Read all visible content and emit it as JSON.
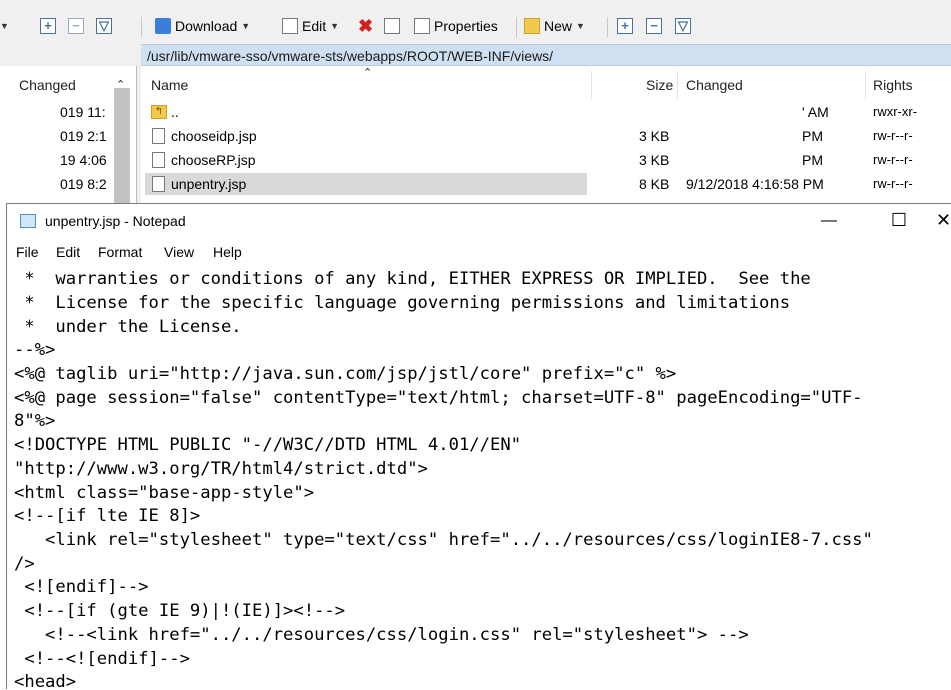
{
  "winscp": {
    "toolbar": {
      "download_label": "Download",
      "edit_label": "Edit",
      "properties_label": "Properties",
      "new_label": "New"
    },
    "path": "/usr/lib/vmware-sso/vmware-sts/webapps/ROOT/WEB-INF/views/",
    "left_panel": {
      "header": "Changed",
      "rows": [
        "019 11:",
        "019 2:1",
        "19 4:06",
        "019 8:2"
      ]
    },
    "right_panel": {
      "columns": {
        "name": "Name",
        "size": "Size",
        "changed": "Changed",
        "rights": "Rights"
      },
      "rows": [
        {
          "name": "..",
          "size": "",
          "changed": "' AM",
          "rights": "rwxr-xr-"
        },
        {
          "name": "chooseidp.jsp",
          "size": "3 KB",
          "changed": "PM",
          "rights": "rw-r--r-"
        },
        {
          "name": "chooseRP.jsp",
          "size": "3 KB",
          "changed": "PM",
          "rights": "rw-r--r-"
        },
        {
          "name": "unpentry.jsp",
          "size": "8 KB",
          "changed": "9/12/2018 4:16:58 PM",
          "rights": "rw-r--r-"
        }
      ]
    }
  },
  "notepad": {
    "title": "unpentry.jsp - Notepad",
    "menu": [
      "File",
      "Edit",
      "Format",
      "View",
      "Help"
    ],
    "lines": [
      " *  warranties or conditions of any kind, EITHER EXPRESS OR IMPLIED.  See the",
      " *  License for the specific language governing permissions and limitations",
      " *  under the License.",
      "--%>",
      "<%@ taglib uri=\"http://java.sun.com/jsp/jstl/core\" prefix=\"c\" %>",
      "<%@ page session=\"false\" contentType=\"text/html; charset=UTF-8\" pageEncoding=\"UTF-",
      "8\"%>",
      "<!DOCTYPE HTML PUBLIC \"-//W3C//DTD HTML 4.01//EN\"",
      "\"http://www.w3.org/TR/html4/strict.dtd\">",
      "<html class=\"base-app-style\">",
      "<!--[if lte IE 8]>",
      "   <link rel=\"stylesheet\" type=\"text/css\" href=\"../../resources/css/loginIE8-7.css\"",
      "/>",
      " <![endif]-->",
      " <!--[if (gte IE 9)|!(IE)]><!-->",
      "   <!--<link href=\"../../resources/css/login.css\" rel=\"stylesheet\"> -->",
      " <!--<![endif]-->",
      "<head>"
    ]
  }
}
